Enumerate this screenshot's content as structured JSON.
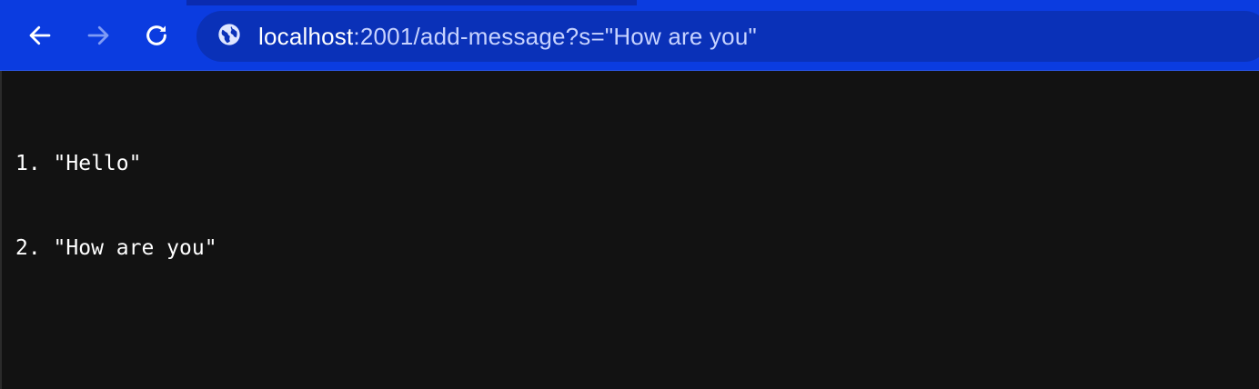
{
  "browser": {
    "nav": {
      "back_icon": "arrow-left-icon",
      "forward_icon": "arrow-right-icon",
      "reload_icon": "reload-icon"
    },
    "omnibox": {
      "site_info_icon": "globe-icon",
      "url_host": "localhost",
      "url_rest": ":2001/add-message?s=\"How are you\""
    },
    "colors": {
      "toolbar": "#0b3ce0",
      "omnibox": "#0a31b8",
      "content_bg": "#121212",
      "text": "#ffffff"
    }
  },
  "page": {
    "messages": [
      "1. \"Hello\"",
      "2. \"How are you\""
    ]
  }
}
